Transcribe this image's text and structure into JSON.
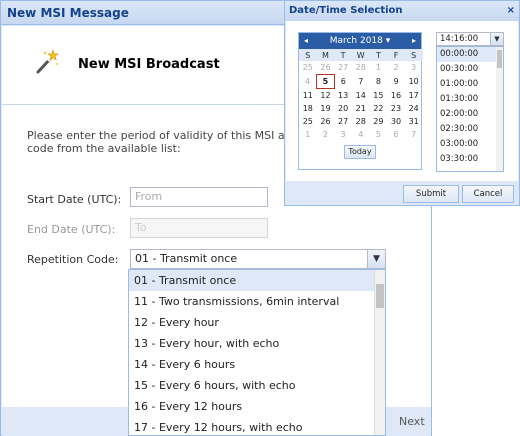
{
  "dialog": {
    "title": "New MSI Message",
    "banner_title": "New MSI Broadcast",
    "instructions": "Please enter the period of validity of this MSI and select a repetition code from the available list:",
    "start_label": "Start Date (UTC):",
    "start_placeholder": "From",
    "end_label": "End Date (UTC):",
    "end_placeholder": "To",
    "repetition_label": "Repetition Code:",
    "repetition_value": "01 - Transmit once",
    "next_label": "Next"
  },
  "repetition_options": [
    "01 - Transmit once",
    "11 - Two transmissions, 6min interval",
    "12 - Every hour",
    "13 - Every hour, with echo",
    "14 - Every 6 hours",
    "15 - Every 6 hours, with echo",
    "16 - Every 12 hours",
    "17 - Every 12 hours, with echo"
  ],
  "datetime": {
    "title": "Date/Time Selection",
    "close": "×",
    "month_label": "March 2018",
    "month_caret": "▾",
    "prev": "◂",
    "next": "▸",
    "days_of_week": [
      "S",
      "M",
      "T",
      "W",
      "T",
      "F",
      "S"
    ],
    "weeks": [
      [
        "25",
        "26",
        "27",
        "28",
        "1",
        "2",
        "3"
      ],
      [
        "4",
        "5",
        "6",
        "7",
        "8",
        "9",
        "10"
      ],
      [
        "11",
        "12",
        "13",
        "14",
        "15",
        "16",
        "17"
      ],
      [
        "18",
        "19",
        "20",
        "21",
        "22",
        "23",
        "24"
      ],
      [
        "25",
        "26",
        "27",
        "28",
        "29",
        "30",
        "31"
      ],
      [
        "1",
        "2",
        "3",
        "4",
        "5",
        "6",
        "7"
      ]
    ],
    "today_label": "Today",
    "time_value": "14:16:00",
    "times": [
      "00:00:00",
      "00:30:00",
      "01:00:00",
      "01:30:00",
      "02:00:00",
      "02:30:00",
      "03:00:00",
      "03:30:00"
    ],
    "submit_label": "Submit",
    "cancel_label": "Cancel"
  },
  "colors": {
    "header_blue": "#15428b",
    "calendar_head": "#2a5da5",
    "frame": "#dfe8f6"
  }
}
